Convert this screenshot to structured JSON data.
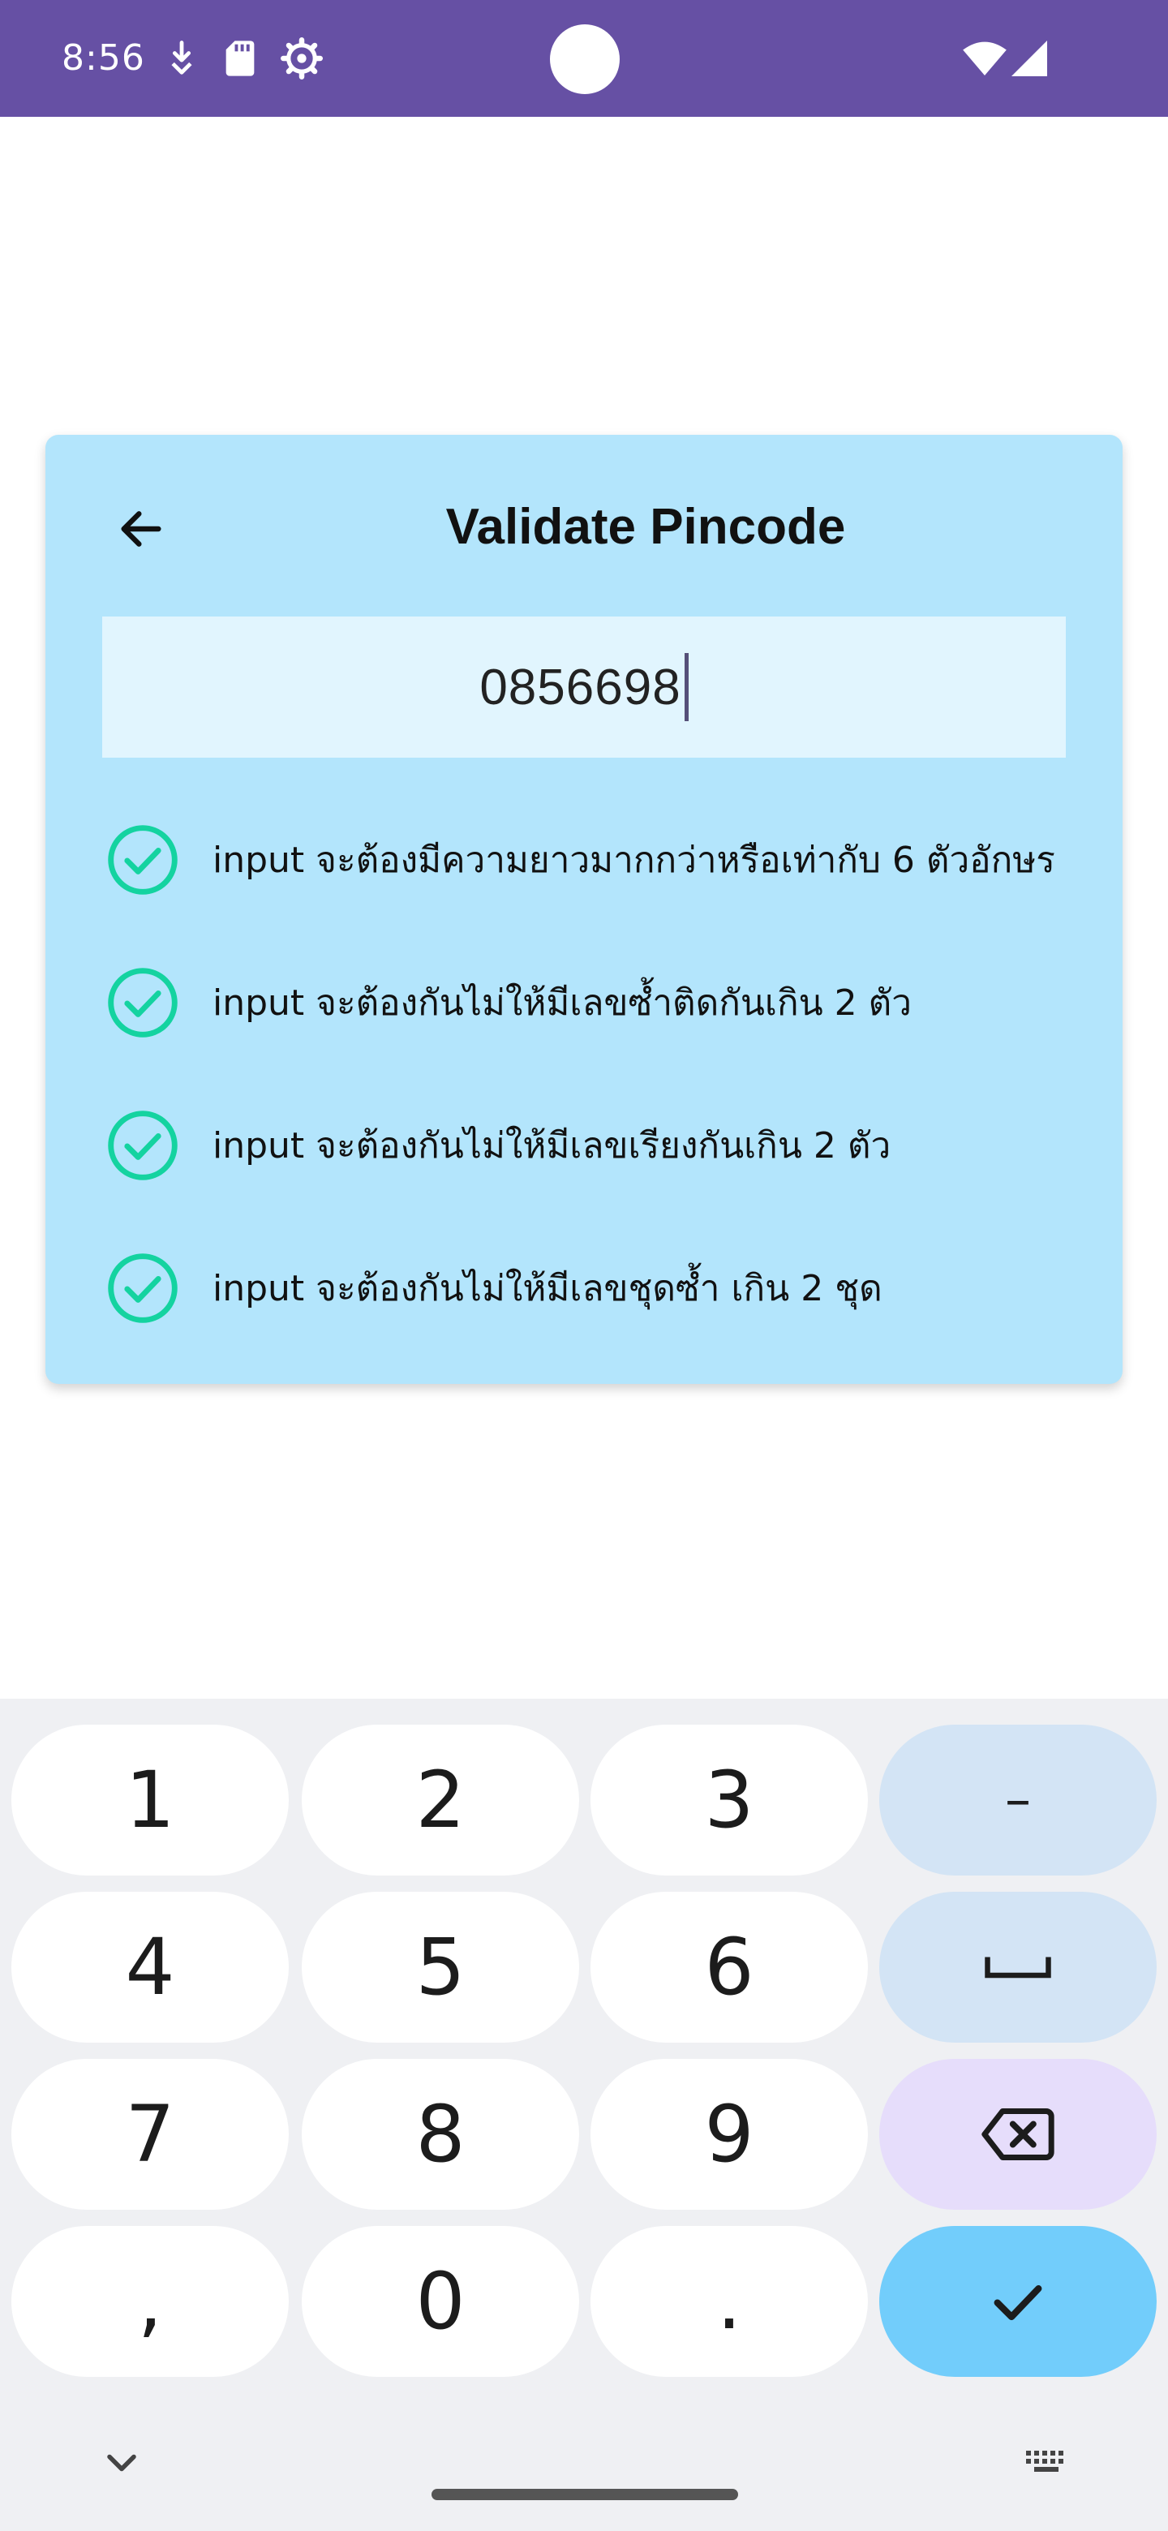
{
  "status_bar": {
    "time": "8:56",
    "icons": [
      "download-arrow-icon",
      "sd-card-icon",
      "settings-gear-icon",
      "wifi-icon",
      "cellular-signal-icon"
    ]
  },
  "colors": {
    "statusbar": "#6650a4",
    "card": "#b3e5fc",
    "input_bg": "#e1f5fe",
    "check": "#14d3a0",
    "keyboard_bg": "#eff0f3",
    "enter_key": "#72cdfb"
  },
  "header": {
    "back_icon": "arrow-left-icon",
    "title": "Validate Pincode"
  },
  "pin_input": {
    "value": "0856698"
  },
  "rules": [
    {
      "text": "input จะต้องมีความยาวมากกว่าหรือเท่ากับ 6 ตัวอักษร",
      "passed": true
    },
    {
      "text": "input จะต้องกันไม่ให้มีเลขซ้ำติดกันเกิน 2 ตัว",
      "passed": true
    },
    {
      "text": "input จะต้องกันไม่ให้มีเลขเรียงกันเกิน 2 ตัว",
      "passed": true
    },
    {
      "text": "input จะต้องกันไม่ให้มีเลขชุดซ้ำ เกิน 2 ชุด",
      "passed": true
    }
  ],
  "keyboard": {
    "rows": [
      [
        "1",
        "2",
        "3",
        "–"
      ],
      [
        "4",
        "5",
        "6",
        "space"
      ],
      [
        "7",
        "8",
        "9",
        "backspace"
      ],
      [
        ",",
        "0",
        ".",
        "done"
      ]
    ],
    "labels": {
      "k1": "1",
      "k2": "2",
      "k3": "3",
      "dash": "–",
      "k4": "4",
      "k5": "5",
      "k6": "6",
      "k7": "7",
      "k8": "8",
      "k9": "9",
      "comma": ",",
      "k0": "0",
      "period": "."
    },
    "bottom_icons": [
      "chevron-down-icon",
      "keyboard-icon"
    ]
  }
}
